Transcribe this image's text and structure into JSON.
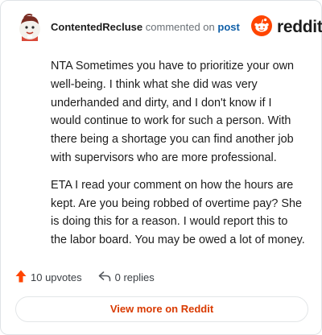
{
  "header": {
    "username": "ContentedRecluse",
    "action": "commented on",
    "target": "post",
    "avatar_icon": "user-avatar-icon",
    "logo_text": "reddit",
    "logo_icon": "reddit-snoo-icon"
  },
  "comment": {
    "paragraphs": [
      "NTA Sometimes you have to prioritize your own well-being. I think what she did was very underhanded and dirty, and I don't know if I would continue to work for such a person. With there being a shortage you can find another job with supervisors who are more professional.",
      "ETA I read your comment on how the hours are kept. Are you being robbed of overtime pay? She is doing this for a reason. I would report this to the labor board. You may be owed a lot of money."
    ]
  },
  "actions": {
    "upvotes_label": "10 upvotes",
    "upvote_icon": "upvote-arrow-icon",
    "replies_label": "0 replies",
    "reply_icon": "reply-arrow-icon"
  },
  "footer": {
    "view_more_label": "View more on Reddit"
  },
  "colors": {
    "brand": "#ff4500",
    "link": "#0f5fa8",
    "view_more_text": "#d93a00",
    "border": "#dfe3e6"
  }
}
